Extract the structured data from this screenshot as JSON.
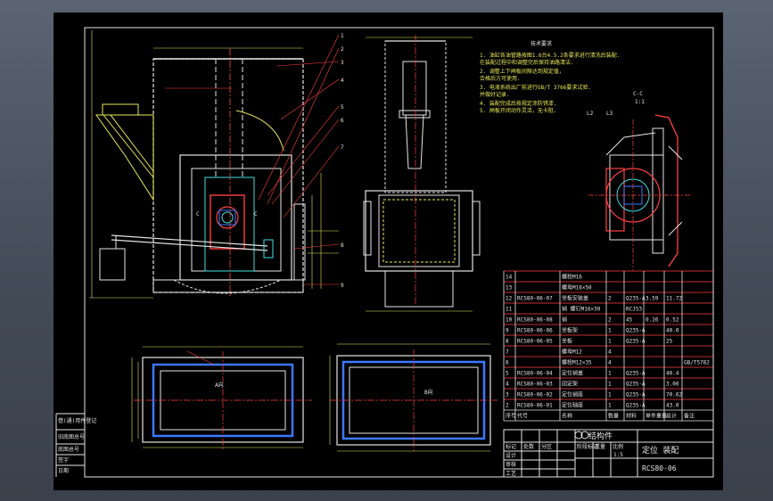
{
  "drawing": {
    "notes": {
      "title": "技术要求",
      "lines": [
        "1. 油缸各油管路按图1.6台4.5.2条要求进行清洗后装配.",
        "   在装配过程中和调整完后保持油路清洁.",
        "2. 调整上下闸板间隙达到规定值，",
        "   合格后方可使用.",
        "3. 电液系统出厂前进行GB/T 3766要求试验.",
        "   并做好记录.",
        "4. 装配完成后按规定涂防锈漆.",
        "5. 闸板开闭动作灵活，无卡阻."
      ]
    },
    "view_labels": {
      "a_view": "A向",
      "b_view": "B向",
      "cc_section": "C-C",
      "cc_scale": "1:1",
      "side_l2": "L2",
      "side_l3": "L3"
    },
    "callouts": [
      "1",
      "2",
      "3",
      "4",
      "5",
      "6",
      "7",
      "8",
      "9",
      "10",
      "11"
    ],
    "bom": {
      "rows": [
        {
          "no": "14",
          "code": "",
          "name": "螺栓M16",
          "qty": "",
          "material": "",
          "unit": "",
          "total": "",
          "note": ""
        },
        {
          "no": "13",
          "code": "",
          "name": "螺母M16×50",
          "qty": "",
          "material": "",
          "unit": "",
          "total": "",
          "note": ""
        },
        {
          "no": "12",
          "code": "RCS80-06-07",
          "name": "坐板安装盖",
          "qty": "2",
          "material": "Q235-A",
          "unit": "3.59",
          "total": "11.72",
          "note": ""
        },
        {
          "no": "11",
          "code": "",
          "name": "销 螺钉M16×30",
          "qty": "",
          "material": "RCJ53",
          "unit": "",
          "total": "",
          "note": ""
        },
        {
          "no": "10",
          "code": "RCS80-06-08",
          "name": "销",
          "qty": "2",
          "material": "45",
          "unit": "0.26",
          "total": "0.52",
          "note": ""
        },
        {
          "no": "9",
          "code": "RCS80-06-06",
          "name": "坐板架",
          "qty": "1",
          "material": "Q235-A",
          "unit": "",
          "total": "40.0",
          "note": ""
        },
        {
          "no": "8",
          "code": "RCS80-06-05",
          "name": "坐板",
          "qty": "1",
          "material": "Q235-A",
          "unit": "",
          "total": "25",
          "note": ""
        },
        {
          "no": "7",
          "code": "",
          "name": "螺母M12",
          "qty": "4",
          "material": "",
          "unit": "",
          "total": "",
          "note": ""
        },
        {
          "no": "6",
          "code": "",
          "name": "螺栓M12×35",
          "qty": "4",
          "material": "",
          "unit": "",
          "total": "",
          "note": "GB/T5782"
        },
        {
          "no": "5",
          "code": "RCS80-06-04",
          "name": "定位销盖",
          "qty": "1",
          "material": "Q235-A",
          "unit": "",
          "total": "40.4",
          "note": ""
        },
        {
          "no": "4",
          "code": "RCS80-06-03",
          "name": "固定架",
          "qty": "1",
          "material": "Q235-A",
          "unit": "",
          "total": "3.00",
          "note": ""
        },
        {
          "no": "3",
          "code": "RCS80-06-02",
          "name": "定位销座",
          "qty": "1",
          "material": "Q235-A",
          "unit": "",
          "total": "70.62",
          "note": ""
        },
        {
          "no": "2",
          "code": "RCS80-06-01",
          "name": "定位轴座",
          "qty": "1",
          "material": "Q235-A",
          "unit": "",
          "total": "43.0",
          "note": ""
        }
      ],
      "header": [
        "序号",
        "代号",
        "名称",
        "数量",
        "材料",
        "单件重量",
        "总计",
        "备注"
      ]
    },
    "title_block": {
      "company": "结构件",
      "drawing_name": "定位 装配",
      "drawing_no": "RCS80-06",
      "left_labels": [
        "标记",
        "处数",
        "分区",
        "更改文件号",
        "签名",
        "日期"
      ],
      "role_labels": [
        "设计",
        "审核",
        "工艺",
        "批准"
      ],
      "stage_labels": [
        "阶段标记",
        "重量",
        "比例"
      ],
      "scale": "1:5"
    },
    "margin_labels": [
      "借(通)用件登记",
      "旧底图总号",
      "底图总号",
      "签字",
      "日期"
    ],
    "colors": {
      "line_white": "#e6e6e6",
      "line_yellow": "#e8e85a",
      "line_red": "#ff4040",
      "line_cyan": "#40e0e0",
      "line_magenta": "#ff40ff",
      "line_blue": "#3c78ff",
      "background": "#000000"
    }
  }
}
